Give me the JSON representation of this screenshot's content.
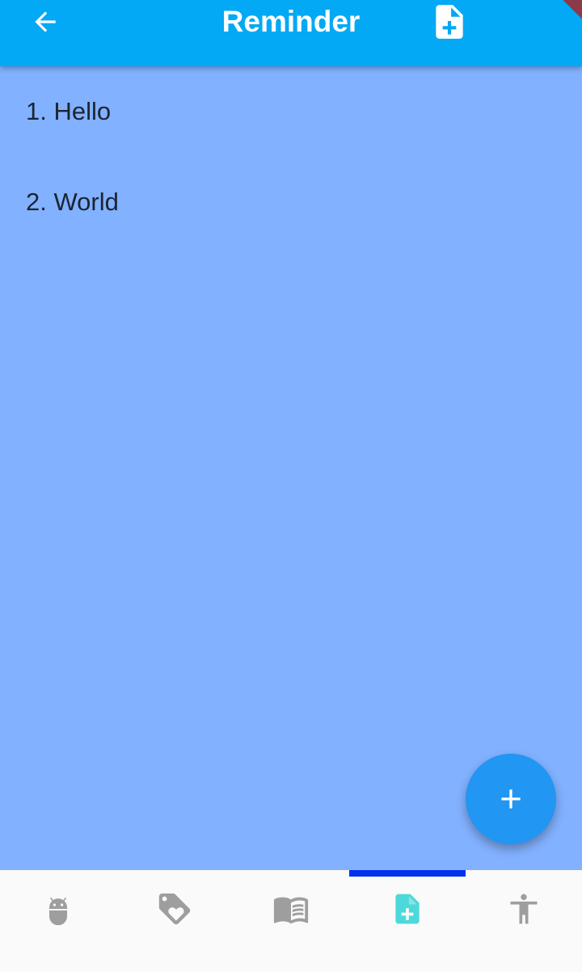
{
  "appbar": {
    "title": "Reminder",
    "back_icon": "arrow-back-icon",
    "action_icon": "note-add-icon",
    "background": "#03a9f4"
  },
  "reminders": [
    {
      "label": "1. Hello"
    },
    {
      "label": "2. World"
    }
  ],
  "fab": {
    "icon": "add-icon",
    "background": "#2196f3"
  },
  "bottom_nav": {
    "active_index": 3,
    "active_color": "#4dd9d9",
    "inactive_color": "#9e9e9e",
    "indicator_color": "#0033ee",
    "items": [
      {
        "icon": "android-icon"
      },
      {
        "icon": "loyalty-tag-icon"
      },
      {
        "icon": "menu-book-icon"
      },
      {
        "icon": "note-add-icon"
      },
      {
        "icon": "accessibility-icon"
      }
    ]
  },
  "colors": {
    "page_background": "#82b1ff",
    "text": "#1b2431"
  }
}
